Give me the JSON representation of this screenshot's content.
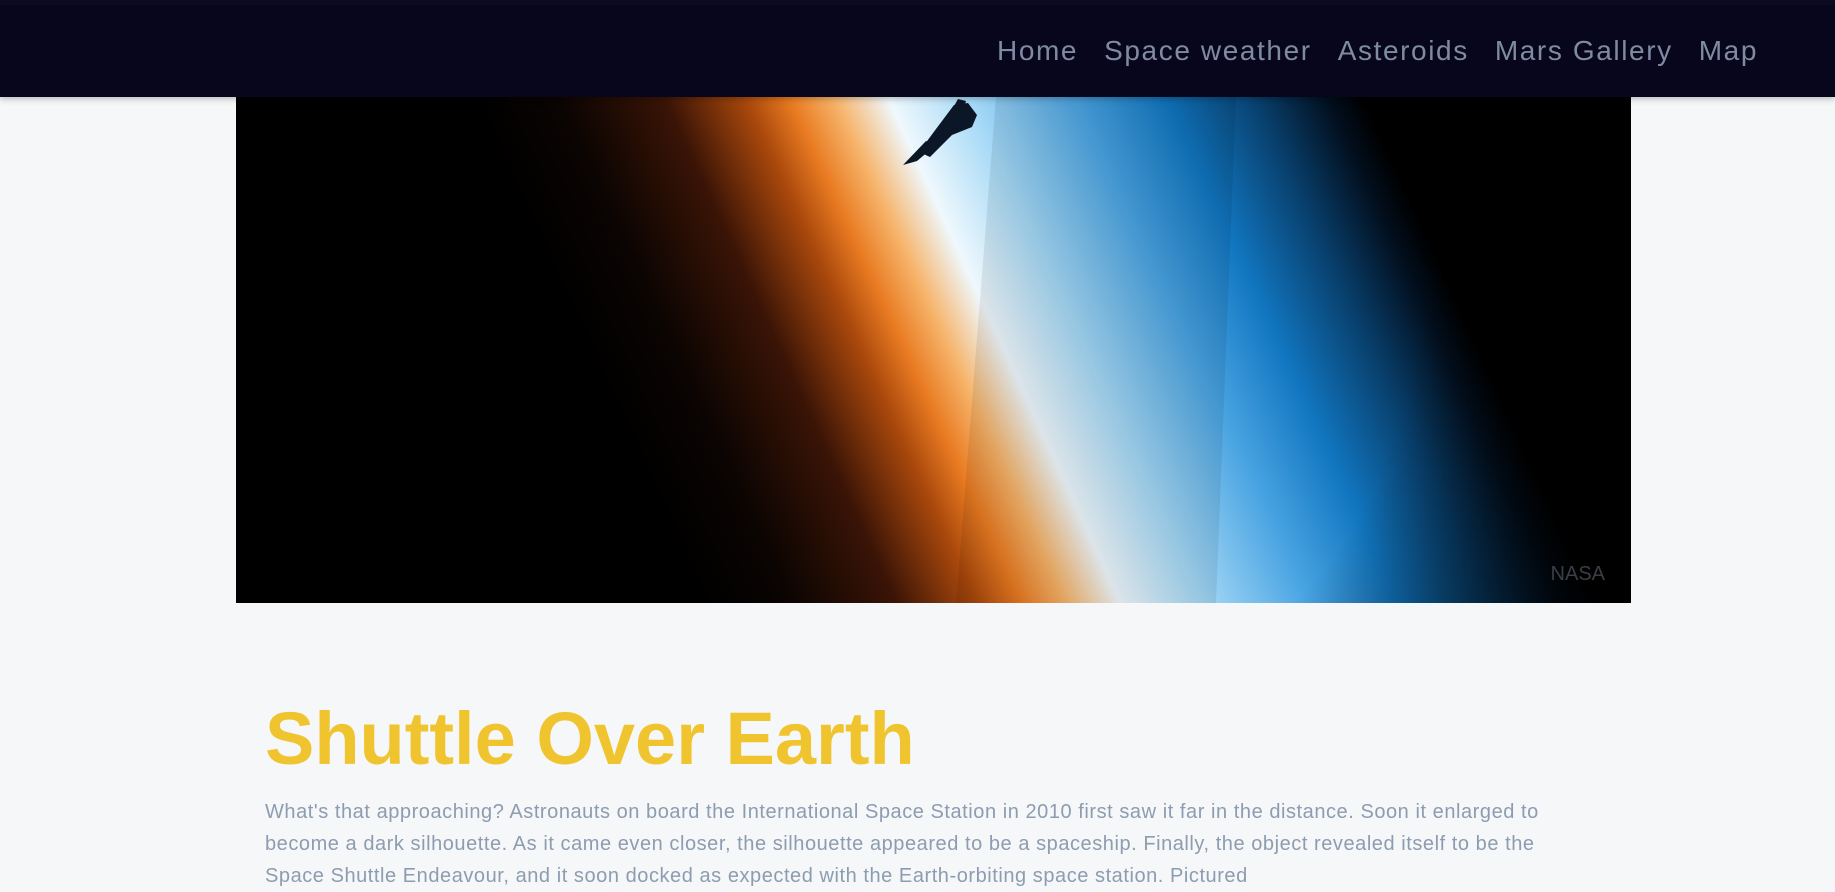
{
  "nav": {
    "items": [
      {
        "label": "Home"
      },
      {
        "label": "Space weather"
      },
      {
        "label": "Asteroids"
      },
      {
        "label": "Mars Gallery"
      },
      {
        "label": "Map"
      }
    ]
  },
  "hero": {
    "credit": "NASA"
  },
  "article": {
    "title": "Shuttle Over Earth",
    "description": "What's that approaching? Astronauts on board the International Space Station in 2010 first saw it far in the distance. Soon it enlarged to become a dark silhouette. As it came even closer, the silhouette appeared to be a spaceship. Finally, the object revealed itself to be the Space Shuttle Endeavour, and it soon docked as expected with the Earth-orbiting space station. Pictured"
  },
  "colors": {
    "nav_background": "#07061c",
    "nav_text": "#7f8ba3",
    "title": "#f0c42e",
    "body_text": "#8d9cb0",
    "page_background": "#f5f7f8"
  }
}
